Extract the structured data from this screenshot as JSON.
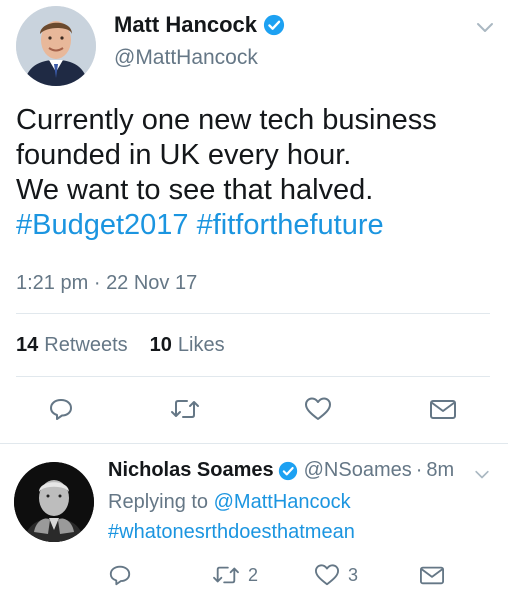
{
  "tweet": {
    "author_name": "Matt Hancock",
    "author_handle": "@MattHancock",
    "text_lines": [
      "Currently one new tech business",
      "founded in UK every hour.",
      "We want to see that halved."
    ],
    "hashtags": [
      "#Budget2017",
      "#fitforthefuture"
    ],
    "time": "1:21 pm",
    "separator": "·",
    "date": "22 Nov 17",
    "retweets_count": "14",
    "retweets_label": "Retweets",
    "likes_count": "10",
    "likes_label": "Likes"
  },
  "reply": {
    "author_name": "Nicholas Soames",
    "author_handle": "@NSoames",
    "separator": "·",
    "time_ago": "8m",
    "replying_prefix": "Replying to",
    "replying_to": "@MattHancock",
    "text": "#whatonesrthdoesthatmean",
    "retweet_count": "2",
    "like_count": "3"
  },
  "icons": {
    "verified": "verified-badge-icon",
    "chevron": "chevron-down-icon",
    "reply": "reply-icon",
    "retweet": "retweet-icon",
    "like": "heart-icon",
    "message": "direct-message-icon"
  },
  "colors": {
    "link": "#1b95e0",
    "verified": "#1da1f2",
    "secondary_text": "#657786",
    "primary_text": "#14171a",
    "divider": "#e1e8ed"
  }
}
